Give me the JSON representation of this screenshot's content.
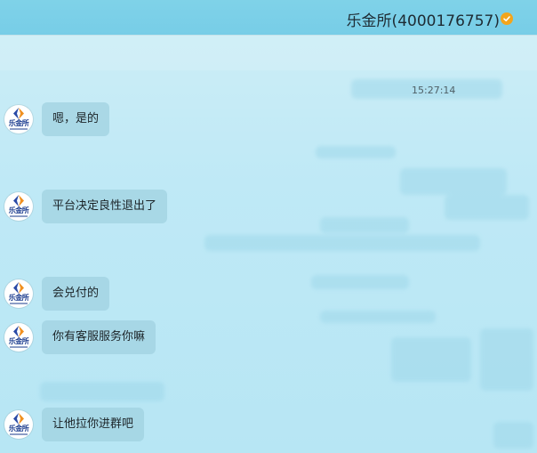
{
  "header": {
    "title": "乐金所(4000176757)",
    "verified_icon": "verified-badge-icon",
    "accent_color": "#f3a51c"
  },
  "chat": {
    "timestamp": "15:27:14",
    "sender_avatar_text": "乐金所",
    "messages": [
      {
        "text": "嗯，是的"
      },
      {
        "text": "平台决定良性退出了"
      },
      {
        "text": "会兑付的"
      },
      {
        "text": "你有客服服务你嘛"
      },
      {
        "text": "让他拉你进群吧"
      }
    ]
  }
}
